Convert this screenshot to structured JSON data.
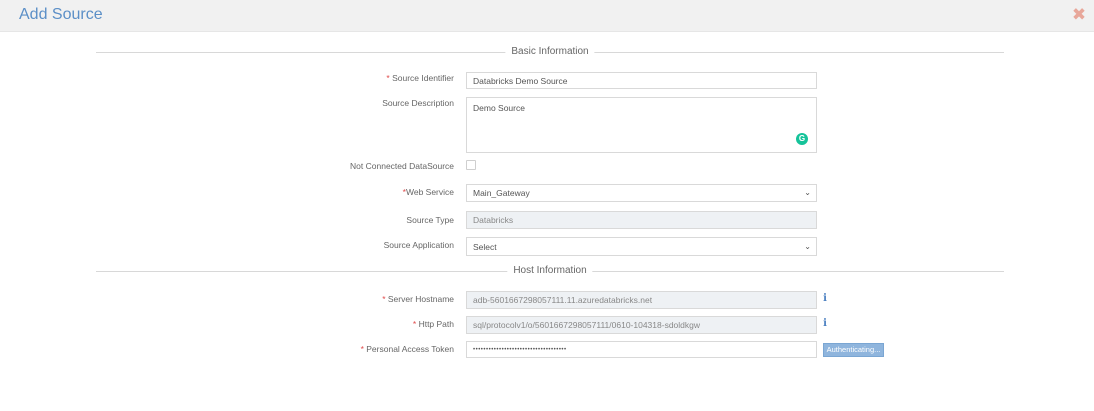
{
  "dialog": {
    "title": "Add Source",
    "close_glyph": "✖"
  },
  "sections": {
    "basic": "Basic Information",
    "host": "Host Information"
  },
  "fields": {
    "source_identifier": {
      "required_mark": "* ",
      "label": "Source Identifier",
      "value": "Databricks Demo Source"
    },
    "source_description": {
      "label": "Source Description",
      "value": "Demo Source"
    },
    "not_connected": {
      "label": "Not Connected DataSource",
      "checked": false
    },
    "web_service": {
      "required_mark": "*",
      "label": "Web Service",
      "value": "Main_Gateway"
    },
    "source_type": {
      "label": "Source Type",
      "value": "Databricks"
    },
    "source_application": {
      "label": "Source Application",
      "value": "Select"
    },
    "server_hostname": {
      "required_mark": "* ",
      "label": "Server Hostname",
      "value": "adb-5601667298057111.11.azuredatabricks.net"
    },
    "http_path": {
      "required_mark": "* ",
      "label": "Http Path",
      "value": "sql/protocolv1/o/5601667298057111/0610-104318-sdoldkgw"
    },
    "personal_access_token": {
      "required_mark": "* ",
      "label": "Personal Access Token",
      "value": "••••••••••••••••••••••••••••••••••••"
    }
  },
  "buttons": {
    "authenticating": "Authenticating..."
  },
  "icons": {
    "info": "i",
    "chevron": "⌄",
    "grammarly": "G"
  },
  "colors": {
    "title": "#5b8fc7",
    "required": "#e04b4b",
    "button": "#8fb5dd",
    "info_icon": "#4a7fc1",
    "grammarly": "#15c39a"
  }
}
